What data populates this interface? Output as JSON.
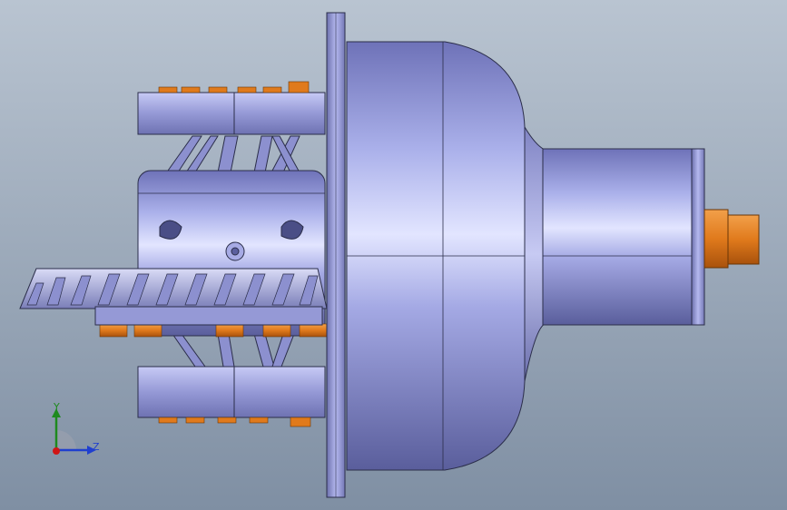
{
  "viewport": {
    "background_top": "#b8c4d2",
    "background_bottom": "#7d8ea3"
  },
  "model": {
    "body_color": "#9a9ed8",
    "highlight_color": "#e6e8ff",
    "shadow_color": "#5b5f9e",
    "edge_color": "#2b2e4a",
    "fastener_color": "#e07a1c",
    "parts": [
      "flange-plate",
      "main-housing",
      "output-shaft",
      "shaft-nut",
      "differential-carrier",
      "bevel-gear",
      "bearing-cap-top",
      "bearing-cap-bottom"
    ]
  },
  "triad": {
    "y_label": "Y",
    "z_label": "Z",
    "y_color": "#1e8a1e",
    "z_color": "#1f3fcf",
    "x_color": "#d01515"
  }
}
